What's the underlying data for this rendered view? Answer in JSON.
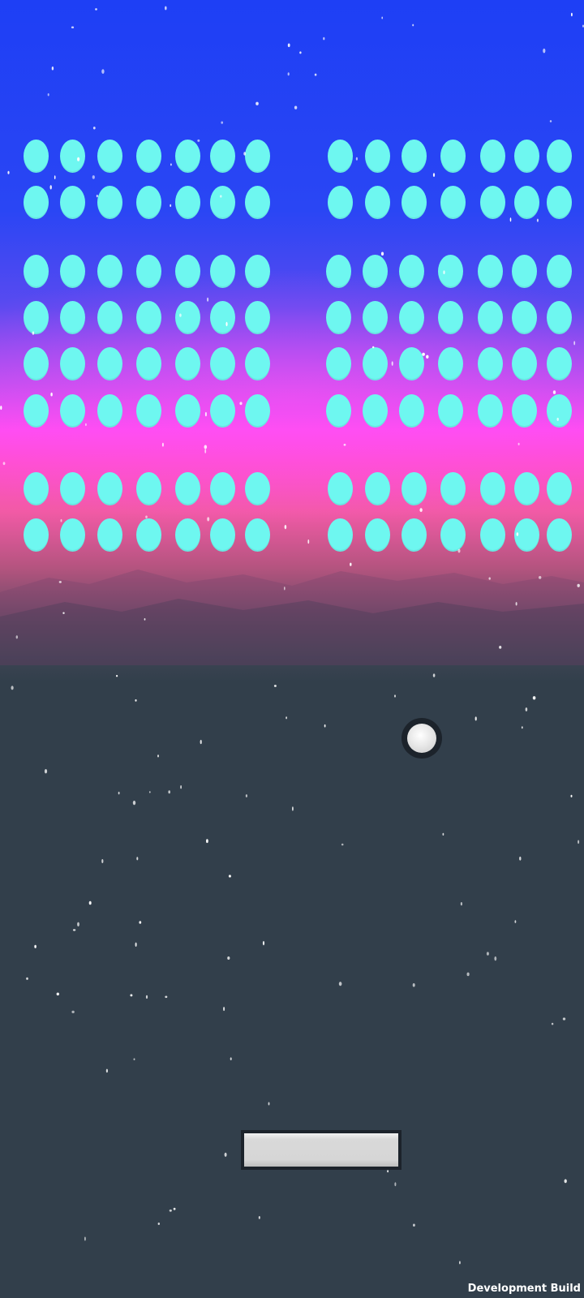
{
  "game": {
    "type": "brick-breaker",
    "colors": {
      "brick": "#6ef7f0",
      "sky_top": "#1e3ff5",
      "horizon": "#ff4cf2",
      "ground": "#323f4b",
      "ball": "#e8e8e8",
      "paddle": "#d6d6d6"
    },
    "brick_groups": [
      {
        "side": "left",
        "rows": 2,
        "cols": 7
      },
      {
        "side": "right",
        "rows": 2,
        "cols": 7
      },
      {
        "side": "left",
        "rows": 4,
        "cols": 7
      },
      {
        "side": "right",
        "rows": 4,
        "cols": 7
      },
      {
        "side": "left",
        "rows": 2,
        "cols": 7
      },
      {
        "side": "right",
        "rows": 2,
        "cols": 7
      }
    ],
    "bricks_remaining": 112
  },
  "overlay": {
    "build_label": "Development Build"
  }
}
